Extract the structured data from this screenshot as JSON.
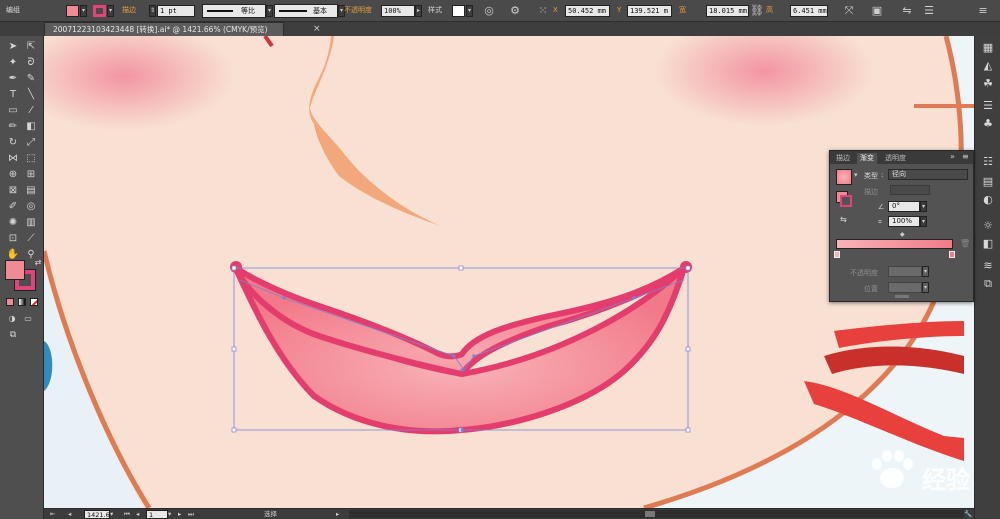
{
  "control_bar": {
    "selection_label": "编组",
    "fill_color": "#f08a95",
    "stroke_color": "#e0447a",
    "stroke_label": "描边",
    "stroke_weight": "1 pt",
    "profile_label": "等比",
    "brush_label": "基本",
    "opacity_label": "不透明度",
    "opacity_value": "100%",
    "style_label": "样式",
    "x_label": "X",
    "x_value": "50.452 mm",
    "y_label": "Y",
    "y_value": "139.521 m",
    "w_label": "宽",
    "w_value": "18.015 mm",
    "h_label": "高",
    "h_value": "6.451 mm"
  },
  "document": {
    "tab_title": "20071223103423448 [转换].ai* @ 1421.66% (CMYK/预览)"
  },
  "gradient_panel": {
    "tabs": [
      "描边",
      "渐变",
      "透明度"
    ],
    "active_tab": "渐变",
    "type_label": "类型",
    "type_value": "径向",
    "stroke_label": "描边",
    "angle_value": "0°",
    "aspect_value": "100%",
    "opacity_label": "不透明度",
    "location_label": "位置",
    "gradient_start": "#f8b2b8",
    "gradient_end": "#f27a88"
  },
  "status_bar": {
    "zoom": "1421.6",
    "page": "1",
    "tool_status": "选择"
  },
  "watermark": {
    "text": "经验"
  },
  "colors": {
    "skin": "#f8e1d2",
    "lip_fill": "#f38f9c",
    "lip_stroke": "#e43d6d",
    "face_outline": "#e07a52",
    "nose": "#f2a87a",
    "blush": "#f7b6c0",
    "bbox": "#7a82d8"
  }
}
